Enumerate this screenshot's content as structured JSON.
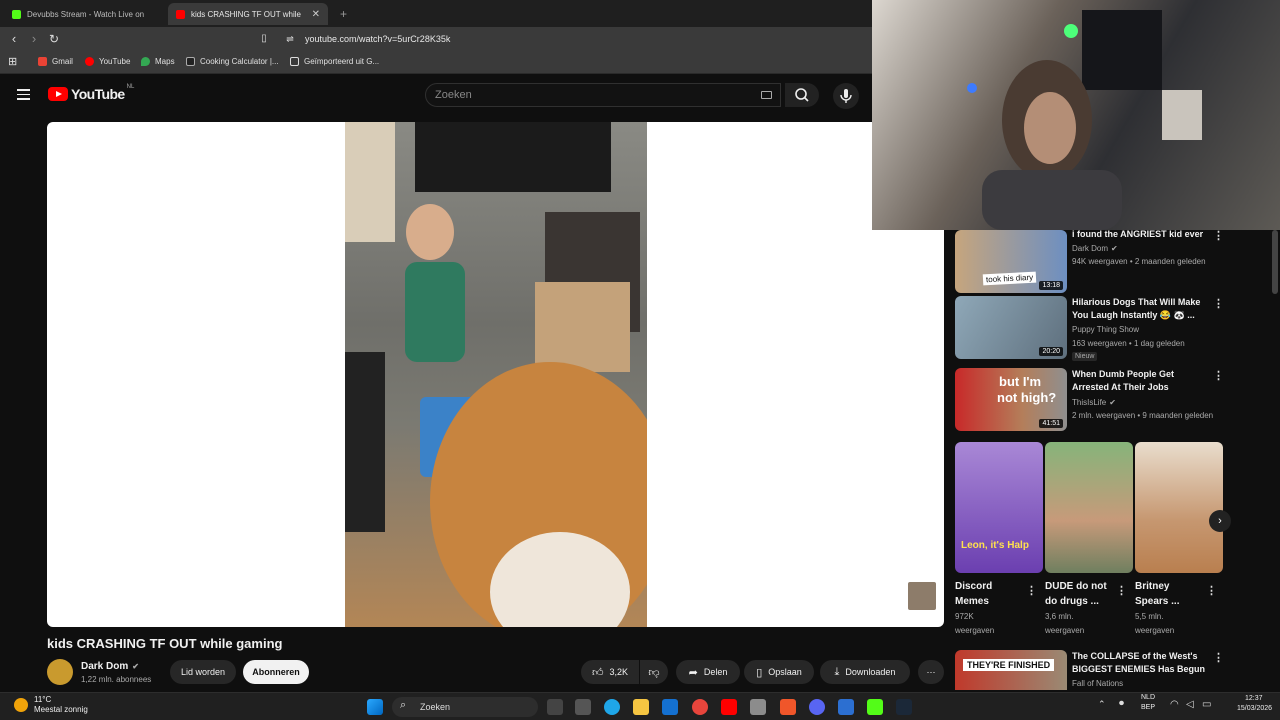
{
  "browser": {
    "tabs": [
      {
        "label": "Devubbs Stream - Watch Live on",
        "active": false
      },
      {
        "label": "kids CRASHING TF OUT while",
        "active": true
      }
    ],
    "new_tab": "+",
    "url": "youtube.com/watch?v=5urCr28K35k",
    "bookmarks": [
      "Gmail",
      "YouTube",
      "Maps",
      "Cooking Calculator |...",
      "Geïmporteerd uit G..."
    ]
  },
  "youtube": {
    "logo_text": "YouTube",
    "logo_suffix": "NL",
    "search_placeholder": "Zoeken"
  },
  "video": {
    "title": "kids CRASHING TF OUT while gaming",
    "channel": "Dark Dom",
    "subscribers": "1,22 mln. abonnees",
    "join_label": "Lid worden",
    "subscribe_label": "Abonneren",
    "likes": "3,2K",
    "share_label": "Delen",
    "save_label": "Opslaan",
    "download_label": "Downloaden",
    "more_label": "⋯"
  },
  "sidebar": {
    "videos": [
      {
        "title": "i found the ANGRIEST kid ever",
        "channel": "Dark Dom",
        "verified": true,
        "meta": "94K weergaven • 2 maanden geleden",
        "duration": "13:18",
        "thumb_text": "took his diary"
      },
      {
        "title": "Hilarious Dogs That Will Make You Laugh Instantly 😂 🐼 ...",
        "channel": "Puppy Thing Show",
        "verified": false,
        "meta": "163 weergaven • 1 dag geleden",
        "badge": "Nieuw",
        "duration": "20:20"
      },
      {
        "title": "When Dumb People Get Arrested At Their Jobs",
        "channel": "ThisIsLife",
        "verified": true,
        "meta": "2 mln. weergaven • 9 maanden geleden",
        "duration": "41:51",
        "thumb_text_1": "but I'm",
        "thumb_text_2": "not high?"
      },
      {
        "title": "The COLLAPSE of the West's BIGGEST ENEMIES Has Begun",
        "channel": "Fall of Nations",
        "thumb_text": "THEY'RE FINISHED"
      }
    ],
    "shorts": [
      {
        "title_1": "Discord",
        "title_2": "Memes",
        "views_1": "972K",
        "views_2": "weergaven",
        "thumb_text": "Leon, it's Halp"
      },
      {
        "title_1": "DUDE do not",
        "title_2": "do drugs ...",
        "views_1": "3,6 mln.",
        "views_2": "weergaven"
      },
      {
        "title_1": "Britney",
        "title_2": "Spears ...",
        "views_1": "5,5 mln.",
        "views_2": "weergaven"
      }
    ]
  },
  "taskbar": {
    "weather_temp": "11°C",
    "weather_desc": "Meestal zonnig",
    "search_label": "Zoeken",
    "lang_1": "NLD",
    "lang_2": "BEP",
    "time": "12:37",
    "date": "15/03/2026"
  },
  "colors": {
    "brand_red": "#ff0000",
    "background": "#0f0f0f",
    "pill": "#272727"
  }
}
